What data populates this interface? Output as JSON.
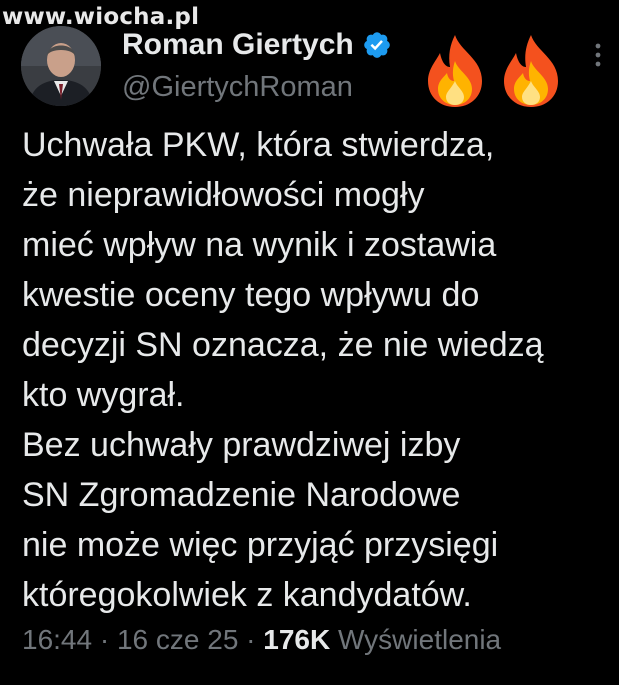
{
  "watermark": "www.wiocha.pl",
  "author": {
    "display_name": "Roman Giertych",
    "handle": "@GiertychRoman",
    "avatar_icon": "portrait-avatar",
    "verified_icon": "verified-badge-icon",
    "verified_color": "#1d9bf0"
  },
  "decorations": {
    "fire_icons": [
      "fire-emoji",
      "fire-emoji"
    ]
  },
  "tweet": {
    "lines": [
      "Uchwała PKW, która stwierdza,",
      "że nieprawidłowości mogły",
      "mieć wpływ na wynik i zostawia",
      "kwestie oceny tego wpływu do",
      "decyzji SN oznacza, że nie wiedzą",
      "kto wygrał.",
      "Bez uchwały prawdziwej izby",
      "SN Zgromadzenie Narodowe",
      "nie może więc przyjąć przysięgi",
      "któregokolwiek z kandydatów."
    ]
  },
  "meta": {
    "time": "16:44",
    "separator": " · ",
    "date": "16 cze 25",
    "views_count": "176K",
    "views_label": "Wyświetlenia"
  },
  "colors": {
    "background": "#000000",
    "text": "#e7e9ea",
    "secondary_text": "#71767b"
  }
}
